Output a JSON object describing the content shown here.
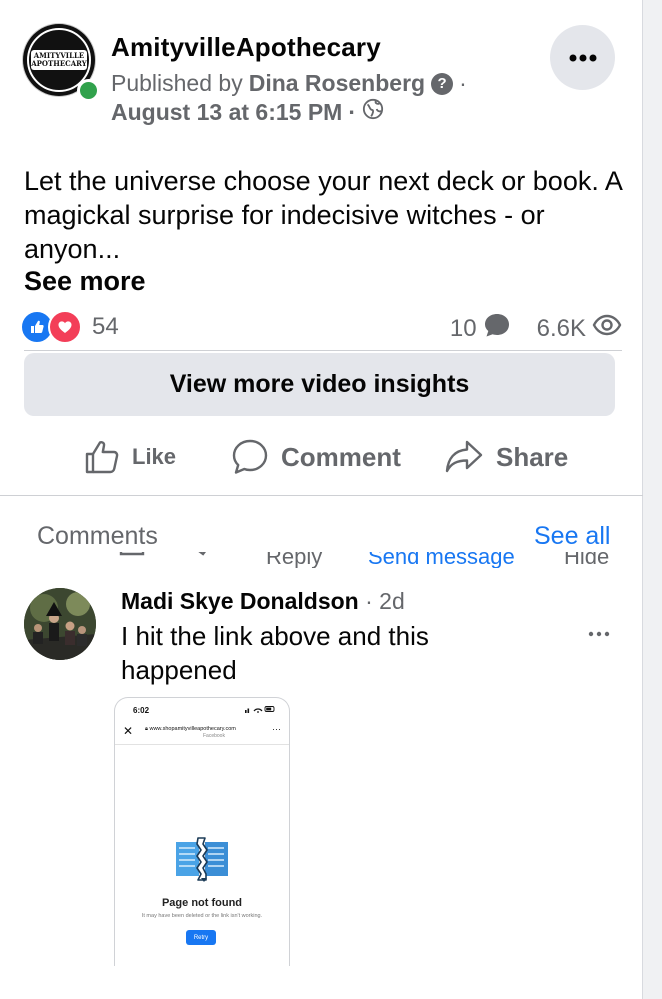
{
  "post": {
    "page_name": "AmityvilleApothecary",
    "avatar_text_line1": "AMITYVILLE",
    "avatar_text_line2": "APOTHECARY",
    "published_by_prefix": "Published by",
    "published_by_name": "Dina Rosenberg",
    "separator": "·",
    "date": "August 13 at 6:15 PM",
    "text": "Let the universe choose your next deck or book. A magickal surprise for indecisive witches - or anyon...",
    "see_more": "See more",
    "reaction_count": "54",
    "comment_count": "10",
    "view_count": "6.6K",
    "insights_button": "View more video insights",
    "actions": {
      "like": "Like",
      "comment": "Comment",
      "share": "Share"
    }
  },
  "comments": {
    "header": "Comments",
    "see_all": "See all",
    "partial_actions": {
      "reply": "Reply",
      "send_message": "Send message",
      "hide": "Hide"
    },
    "items": [
      {
        "author": "Madi Skye Donaldson",
        "time": "2d",
        "text": "I hit the link above and this happened",
        "attachment": {
          "status_time": "6:02",
          "url": "www.shopamityvilleapothecary.com",
          "url_sub": "Facebook",
          "title": "Page not found",
          "description": "It may have been deleted or the link isn't working.",
          "retry": "Retry"
        }
      }
    ]
  },
  "colors": {
    "accent": "#1877f2",
    "secondary_text": "#65676b",
    "online": "#31a24c",
    "love": "#f33e58",
    "button_bg": "#e4e6eb"
  }
}
